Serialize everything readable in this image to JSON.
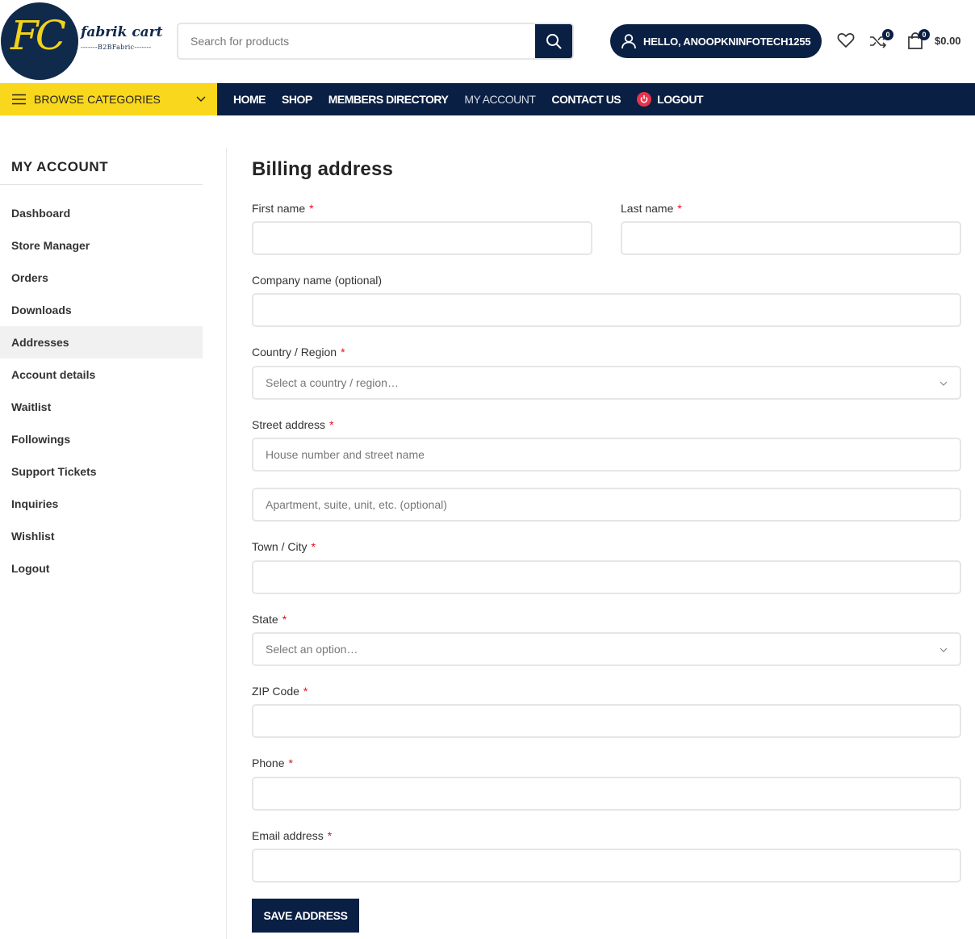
{
  "brand": {
    "logo_monogram": "FC",
    "logo_name": "fabrik cart",
    "logo_tagline": "-------B2BFabric-------"
  },
  "search": {
    "placeholder": "Search for products",
    "button_icon": "search-icon"
  },
  "account_button": {
    "label": "HELLO, ANOOPKNINFOTECH1255",
    "icon": "user-icon"
  },
  "header_icons": {
    "wishlist_icon": "heart-icon",
    "compare_icon": "shuffle-icon",
    "compare_count": "0",
    "cart_icon": "shopping-bag-icon",
    "cart_count": "0",
    "cart_total": "$0.00"
  },
  "browse": {
    "label": "BROWSE CATEGORIES"
  },
  "nav": {
    "items": [
      {
        "label": "HOME"
      },
      {
        "label": "SHOP"
      },
      {
        "label": "MEMBERS DIRECTORY"
      },
      {
        "label": "MY ACCOUNT"
      },
      {
        "label": "CONTACT US"
      },
      {
        "label": "LOGOUT"
      }
    ],
    "active": "MY ACCOUNT"
  },
  "sidebar": {
    "title": "MY ACCOUNT",
    "items": [
      {
        "label": "Dashboard"
      },
      {
        "label": "Store Manager"
      },
      {
        "label": "Orders"
      },
      {
        "label": "Downloads"
      },
      {
        "label": "Addresses"
      },
      {
        "label": "Account details"
      },
      {
        "label": "Waitlist"
      },
      {
        "label": "Followings"
      },
      {
        "label": "Support Tickets"
      },
      {
        "label": "Inquiries"
      },
      {
        "label": "Wishlist"
      },
      {
        "label": "Logout"
      }
    ],
    "active": "Addresses"
  },
  "form": {
    "title": "Billing address",
    "required_mark": "*",
    "first_name_label": "First name",
    "last_name_label": "Last name",
    "company_label": "Company name (optional)",
    "country_label": "Country / Region",
    "country_value": "Select a country / region…",
    "street_label": "Street address",
    "street1_placeholder": "House number and street name",
    "street2_placeholder": "Apartment, suite, unit, etc. (optional)",
    "city_label": "Town / City",
    "state_label": "State",
    "state_value": "Select an option…",
    "zip_label": "ZIP Code",
    "phone_label": "Phone",
    "email_label": "Email address",
    "save_label": "SAVE ADDRESS"
  },
  "colors": {
    "navy": "#0a1f44",
    "yellow": "#f9d71c",
    "required": "#e01020",
    "logout_icon": "#e8334a"
  }
}
